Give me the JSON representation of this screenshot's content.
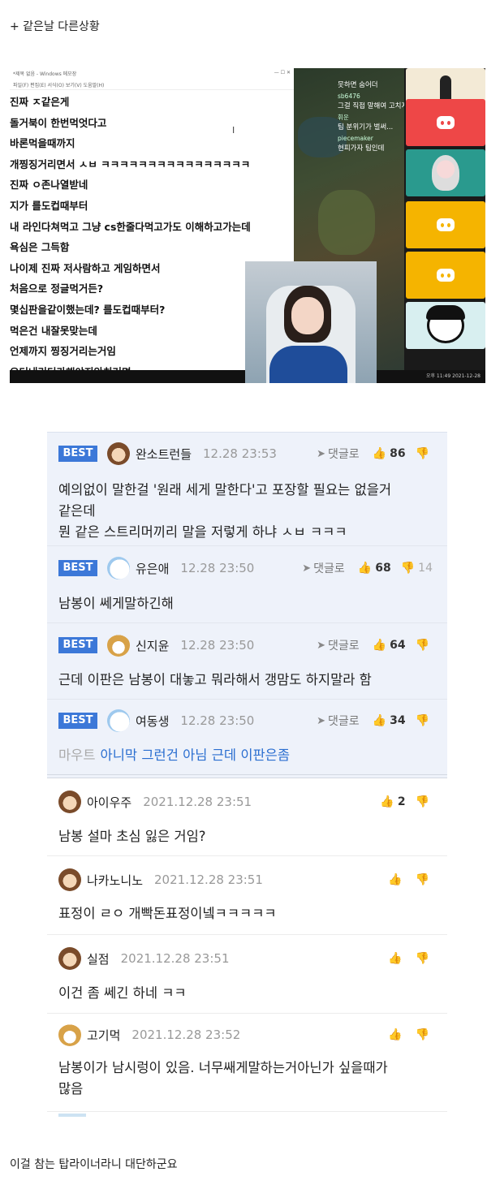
{
  "captions": {
    "top": "+ 같은날 다른상황",
    "bottom": "이걸 참는 탑라이너라니 대단하군요"
  },
  "stream": {
    "notepad_title": "*제목 없음 - Windows 메모장",
    "notepad_menu": "파일(F)  편집(E)  서식(O)  보기(V)  도움말(H)",
    "notepad_lines": [
      "진짜 ㅈ같은게",
      "돌거북이 한번먹엇다고",
      "바론먹을때까지",
      "개찡징거리면서 ㅅㅂ ㅋㅋㅋㅋㅋㅋㅋㅋㅋㅋㅋㅋㅋㅋㅋㅋ",
      "진짜 ㅇ존나열받네",
      "지가 를도컵때부터",
      "내 라인다쳐먹고 그냥 cs한줄다먹고가도 이해하고가는데",
      "욕심은 그득함",
      "나이제 진짜 저사람하고 게임하면서",
      "처음으로 정글먹거든?",
      "몇십판을같이했는데? 를도컵때부터?",
      "먹은건 내잘못맞는데",
      "언제까지 찡징거리는거임",
      "오더내리더가해야지안치거면"
    ],
    "chat": [
      {
        "name": "",
        "text": "못하면 숨어더"
      },
      {
        "name": "sb6476",
        "text": "그걸 직접 말해여 고치지 ——"
      },
      {
        "name": "휘운",
        "text": "팀 분위기가 벌써..."
      },
      {
        "name": "piecemaker",
        "text": "현피가자 팀인데"
      }
    ],
    "tray_time": "오후 11:49",
    "tray_date": "2021-12-28"
  },
  "comments": {
    "best_label": "BEST",
    "reply_label": "댓글로",
    "best": [
      {
        "user": "완소트런들",
        "time": "12.28 23:53",
        "likes": "86",
        "dislikes": "",
        "lines": [
          "예의없이 말한걸 '원래 세게 말한다'고 포장할 필요는 없을거",
          "같은데",
          "뭔 같은 스트리머끼리 말을 저렇게 하냐 ㅅㅂ ㅋㅋㅋ"
        ],
        "avatar": "dog"
      },
      {
        "user": "유은애",
        "time": "12.28 23:50",
        "likes": "68",
        "dislikes": "14",
        "lines": [
          "남봉이 쎄게말하긴해"
        ],
        "avatar": "white"
      },
      {
        "user": "신지윤",
        "time": "12.28 23:50",
        "likes": "64",
        "dislikes": "",
        "lines": [
          "근데 이판은 남봉이 대놓고 뭐라해서 갱맘도 하지말라 함"
        ],
        "avatar": "fox"
      },
      {
        "user": "여동생",
        "time": "12.28 23:50",
        "likes": "34",
        "dislikes": "",
        "mention": "마우트",
        "lines": [
          "아니막 그런건 아님 근데 이판은좀"
        ],
        "avatar": "white"
      }
    ],
    "normal": [
      {
        "user": "아이우주",
        "time": "2021.12.28 23:51",
        "likes": "2",
        "lines": [
          "남봉 설마 초심 잃은 거임?"
        ],
        "avatar": "dog"
      },
      {
        "user": "나카노니노",
        "time": "2021.12.28 23:51",
        "likes": "",
        "lines": [
          "표정이 ㄹㅇ 개빡돈표정이넼ㅋㅋㅋㅋㅋ"
        ],
        "avatar": "dog"
      },
      {
        "user": "실점",
        "time": "2021.12.28 23:51",
        "likes": "",
        "lines": [
          "이건 좀 쎄긴 하네 ㅋㅋ"
        ],
        "avatar": "dog"
      },
      {
        "user": "고기먹",
        "time": "2021.12.28 23:52",
        "likes": "",
        "lines": [
          "남봉이가 남시렁이 있음. 너무쌔게말하는거아닌가 싶을때가",
          "많음"
        ],
        "avatar": "fox"
      }
    ]
  },
  "icons": {
    "reply": "reply-arrow-icon",
    "like": "thumbs-up-icon",
    "dislike": "thumbs-down-icon"
  },
  "colors": {
    "best_badge": "#3c78d8",
    "best_bg": "#eef2fa",
    "mention_link": "#2a6ed0"
  }
}
